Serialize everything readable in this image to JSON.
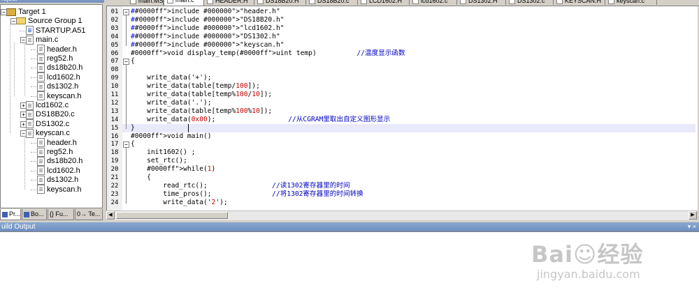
{
  "project": {
    "title": "roject",
    "tree": [
      {
        "label": "Target 1",
        "kind": "target",
        "depth": 0
      },
      {
        "label": "Source Group 1",
        "kind": "folder",
        "depth": 1
      },
      {
        "label": "STARTUP.A51",
        "kind": "asm",
        "depth": 2
      },
      {
        "label": "main.c",
        "kind": "file",
        "depth": 2
      },
      {
        "label": "header.h",
        "kind": "file",
        "depth": 3
      },
      {
        "label": "reg52.h",
        "kind": "file",
        "depth": 3
      },
      {
        "label": "ds18b20.h",
        "kind": "file",
        "depth": 3
      },
      {
        "label": "lcd1602.h",
        "kind": "file",
        "depth": 3
      },
      {
        "label": "ds1302.h",
        "kind": "file",
        "depth": 3
      },
      {
        "label": "keyscan.h",
        "kind": "file",
        "depth": 3
      },
      {
        "label": "lcd1602.c",
        "kind": "file",
        "depth": 2
      },
      {
        "label": "DS18B20.c",
        "kind": "file",
        "depth": 2
      },
      {
        "label": "DS1302.c",
        "kind": "file",
        "depth": 2
      },
      {
        "label": "keyscan.c",
        "kind": "file",
        "depth": 2
      },
      {
        "label": "header.h",
        "kind": "file",
        "depth": 3
      },
      {
        "label": "reg52.h",
        "kind": "file",
        "depth": 3
      },
      {
        "label": "ds18b20.h",
        "kind": "file",
        "depth": 3
      },
      {
        "label": "lcd1602.h",
        "kind": "file",
        "depth": 3
      },
      {
        "label": "ds1302.h",
        "kind": "file",
        "depth": 3
      },
      {
        "label": "keyscan.h",
        "kind": "file",
        "depth": 3
      }
    ],
    "tabs": [
      "Pr...",
      "Bo...",
      "{} Fu...",
      "0→ Te..."
    ]
  },
  "editor": {
    "tabs": [
      "main.MS",
      "main.c",
      "HEADER.H",
      "DS18B20.H",
      "DS18B20.c",
      "LCD1602.H",
      "lcd1602.c",
      "DS1302.H",
      "DS1302.c",
      "KEYSCAN.H",
      "keyscan.c"
    ],
    "lines": [
      {
        "n": "01",
        "text": "#include \"header.h\""
      },
      {
        "n": "02",
        "text": "#include \"DS18B20.h\""
      },
      {
        "n": "03",
        "text": "#include \"lcd1602.h\""
      },
      {
        "n": "04",
        "text": "#include \"DS1302.h\""
      },
      {
        "n": "05",
        "text": "#include \"keyscan.h\""
      },
      {
        "n": "06",
        "text": "void display_temp(uint temp)          //温度显示函数"
      },
      {
        "n": "07",
        "text": "{"
      },
      {
        "n": "08",
        "text": ""
      },
      {
        "n": "09",
        "text": "    write_data('+');"
      },
      {
        "n": "10",
        "text": "    write_data(table[temp/100]);"
      },
      {
        "n": "11",
        "text": "    write_data(table[temp%100/10]);"
      },
      {
        "n": "12",
        "text": "    write_data('.');"
      },
      {
        "n": "13",
        "text": "    write_data(table[temp%100%10]);"
      },
      {
        "n": "14",
        "text": "    write_data(0x00);                  //从CGRAM里取出自定义图形显示"
      },
      {
        "n": "15",
        "text": "}"
      },
      {
        "n": "16",
        "text": "void main()"
      },
      {
        "n": "17",
        "text": "{"
      },
      {
        "n": "18",
        "text": "    init1602() ;"
      },
      {
        "n": "19",
        "text": "    set_rtc();"
      },
      {
        "n": "20",
        "text": "    while(1)"
      },
      {
        "n": "21",
        "text": "    {"
      },
      {
        "n": "22",
        "text": "        read_rtc();                //读1302寄存器里的时间"
      },
      {
        "n": "23",
        "text": "        time_pros();               //将1302寄存器里的时间转换"
      },
      {
        "n": "24",
        "text": "        write_data('2');"
      }
    ],
    "colors": {
      "text": "#000000",
      "string": "#000000",
      "keyword": "#0000ff",
      "comment": "#0000c0",
      "number": "#c00000",
      "highlight": "#e8eafc"
    }
  },
  "build": {
    "title": "uild Output",
    "controls": "▾ ×"
  },
  "watermark": {
    "logo": "Bai☺经验",
    "url": "jingyan.baidu.com"
  }
}
